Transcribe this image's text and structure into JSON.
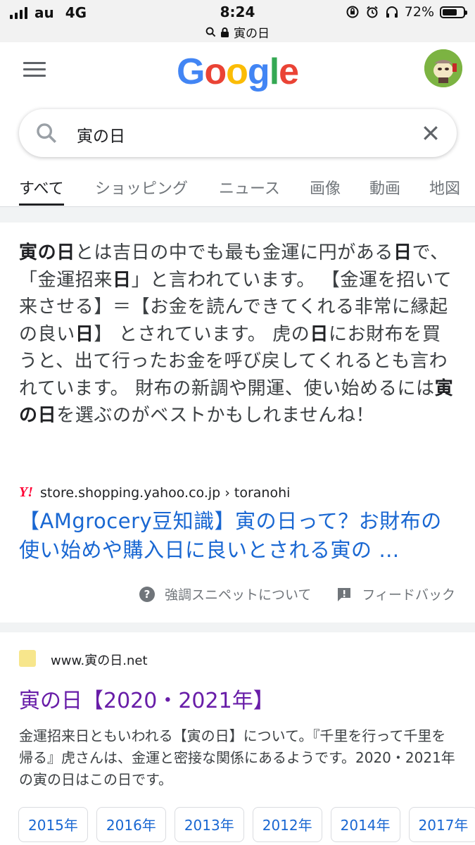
{
  "status_bar": {
    "carrier": "au",
    "network": "4G",
    "time": "8:24",
    "battery": "72%",
    "battery_level": 0.72,
    "url": "寅の日"
  },
  "header": {
    "logo": [
      "G",
      "o",
      "o",
      "g",
      "l",
      "e"
    ]
  },
  "search": {
    "query": "寅の日"
  },
  "tabs": [
    {
      "label": "すべて",
      "active": true
    },
    {
      "label": "ショッピング",
      "active": false
    },
    {
      "label": "ニュース",
      "active": false
    },
    {
      "label": "画像",
      "active": false
    },
    {
      "label": "動画",
      "active": false
    },
    {
      "label": "地図",
      "active": false
    }
  ],
  "featured_snippet": {
    "text_segments": [
      {
        "text": "寅の日",
        "bold": true
      },
      {
        "text": "とは吉日の中でも最も金運に円がある",
        "bold": false
      },
      {
        "text": "日",
        "bold": true
      },
      {
        "text": "で、「金運招来",
        "bold": false
      },
      {
        "text": "日",
        "bold": true
      },
      {
        "text": "」と言われています。 【金運を招いて来させる】＝【お金を読んできてくれる非常に縁起の良い",
        "bold": false
      },
      {
        "text": "日",
        "bold": true
      },
      {
        "text": "】 とされています。 虎の",
        "bold": false
      },
      {
        "text": "日",
        "bold": true
      },
      {
        "text": "にお財布を買うと、出て行ったお金を呼び戻してくれるとも言われています。 財布の新調や開運、使い始めるには",
        "bold": false
      },
      {
        "text": "寅の日",
        "bold": true
      },
      {
        "text": "を選ぶのがベストかもしれませんね！",
        "bold": false
      }
    ],
    "source_logo": "Y!",
    "source_url": "store.shopping.yahoo.co.jp › toranohi",
    "link_title": "【AMgrocery豆知識】寅の日って？お財布の使い始めや購入日に良いとされる寅の …",
    "about_label": "強調スニペットについて",
    "feedback_label": "フィードバック"
  },
  "result2": {
    "site": "www.寅の日.net",
    "title": "寅の日【2020・2021年】",
    "description": "金運招来日ともいわれる【寅の日】について。『千里を行って千里を帰る』虎さんは、金運と密接な関係にあるようです。2020・2021年の寅の日はこの日です。",
    "chips": [
      "2015年",
      "2016年",
      "2013年",
      "2012年",
      "2014年",
      "2017年"
    ]
  }
}
